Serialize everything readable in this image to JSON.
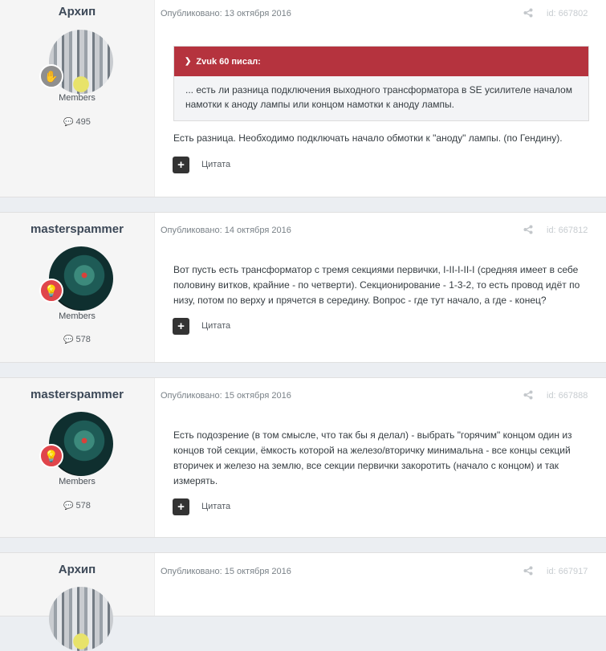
{
  "posts": [
    {
      "author": "Архип",
      "avatar": "archip-avatar",
      "group": "Members",
      "count": "495",
      "date": "Опубликовано: 13 октября 2016",
      "id": "id: 667802",
      "quote": {
        "header": "Zvuk 60 писал:",
        "text": "... есть ли разница подключения выходного трансформатора в SE усилителе началом намотки к аноду лампы или концом намотки к аноду лампы."
      },
      "text": "Есть разница. Необходимо подключать начало обмотки к \"аноду\" лампы. (по Гендину).",
      "quote_label": "Цитата"
    },
    {
      "author": "masterspammer",
      "avatar": "masterspammer-avatar",
      "group": "Members",
      "count": "578",
      "date": "Опубликовано: 14 октября 2016",
      "id": "id: 667812",
      "text": "Вот пусть есть трансформатор с тремя секциями первички, I-II-I-II-I (средняя имеет в себе половину витков, крайние - по четверти). Секционирование - 1-3-2, то есть провод идёт по низу, потом по верху и прячется в середину. Вопрос - где тут начало, а где - конец?",
      "quote_label": "Цитата"
    },
    {
      "author": "masterspammer",
      "avatar": "masterspammer-avatar",
      "group": "Members",
      "count": "578",
      "date": "Опубликовано: 15 октября 2016",
      "id": "id: 667888",
      "text": "Есть подозрение (в том смысле, что так бы я делал) - выбрать \"горячим\" концом один из концов той секции, ёмкость которой на железо/вторичку минимальна - все концы секций вторичек и железо на землю, все секции первички закоротить (начало с концом) и так измерять.",
      "quote_label": "Цитата"
    },
    {
      "author": "Архип",
      "avatar": "archip-avatar",
      "date": "Опубликовано: 15 октября 2016",
      "id": "id: 667917"
    }
  ],
  "icons": {
    "rank_archip": "✋",
    "rank_master": "💡",
    "comment": "💬",
    "share": "share-icon",
    "chevron": "chevron-down-icon",
    "plus": "+"
  }
}
